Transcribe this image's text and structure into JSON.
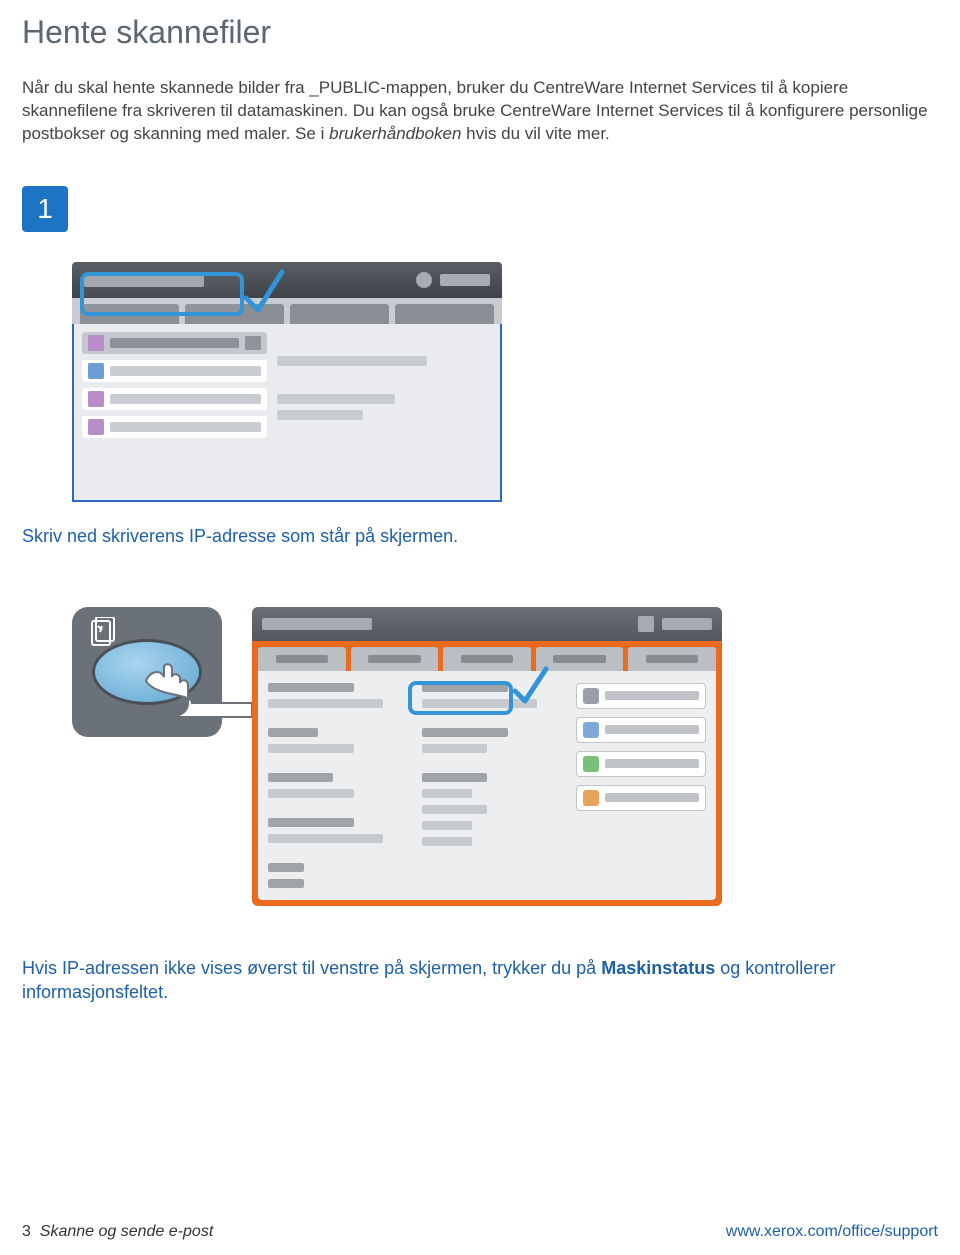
{
  "title": "Hente skannefiler",
  "intro_part1": "Når du skal hente skannede bilder fra _PUBLIC-mappen, bruker du CentreWare Internet Services til å kopiere skannefilene fra skriveren til datamaskinen. Du kan også bruke CentreWare Internet Services til å konfigurere personlige postbokser og skanning med maler. Se i ",
  "intro_italic": "brukerhåndboken",
  "intro_part2": " hvis du vil vite mer.",
  "step_number": "1",
  "step_caption": "Skriv ned skriverens IP-adresse som står på skjermen.",
  "final_p1": "Hvis IP-adressen ikke vises øverst til venstre på skjermen, trykker du på ",
  "final_bold": "Maskinstatus",
  "final_p2": " og kontrollerer informasjonsfeltet.",
  "footer_page": "3",
  "footer_title": "Skanne og sende e-post",
  "footer_url": "www.xerox.com/office/support"
}
